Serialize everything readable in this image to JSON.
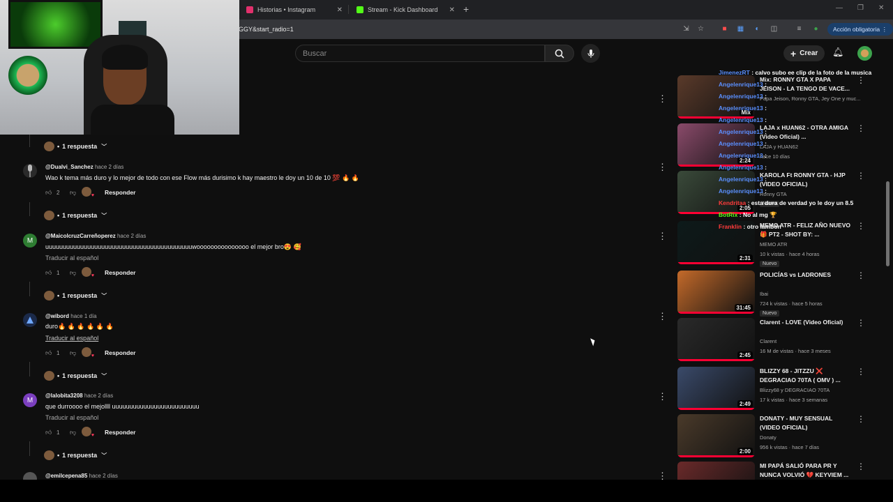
{
  "browser": {
    "tabs": [
      {
        "label": "Historias • Instagram",
        "color": "#e1306c"
      },
      {
        "label": "Stream - Kick Dashboard",
        "color": "#53fc18"
      }
    ],
    "url": "GGY&start_radio=1",
    "action_label": "Acción obligatoria"
  },
  "youtube": {
    "search_placeholder": "Buscar",
    "create_label": "Crear"
  },
  "comments": [
    {
      "handle": "@Dualvi_Sanchez",
      "time": "hace 2 días",
      "text": "Wao k tema más duro y lo mejor de todo con ese Flow más durisimo k hay maestro  le doy un 10 de 10 💯 🔥 🔥",
      "likes": "2",
      "reply_label": "Responder",
      "replies": "1 respuesta",
      "translate": ""
    },
    {
      "handle": "@MaicolcruzCarreñoperez",
      "time": "hace 2 días",
      "text": "uuuuuuuuuuuuuuuuuuuuuuuuuuuuuuuuuuuuuuuuuuwooooooooooooooo el mejor bro😍 🥰",
      "likes": "1",
      "reply_label": "Responder",
      "replies": "1 respuesta",
      "translate": "Traducir al español",
      "initial": "M",
      "av_color": "#2e7d32"
    },
    {
      "handle": "@wibord",
      "time": "hace 1 día",
      "text": "duro🔥 🔥 🔥 🔥 🔥 🔥",
      "likes": "1",
      "reply_label": "Responder",
      "replies": "1 respuesta",
      "translate": "Traducir al español"
    },
    {
      "handle": "@lalobita3208",
      "time": "hace 2 días",
      "text": "que durroooo el mejollll uuuuuuuuuuuuuuuuuuuuuuuuu",
      "likes": "1",
      "reply_label": "Responder",
      "replies": "1 respuesta",
      "translate": "Traducir al español",
      "initial": "M",
      "av_color": "#7b3fbf"
    },
    {
      "handle": "@emilcepena85",
      "time": "hace 2 días"
    }
  ],
  "top_replies": "1 respuesta",
  "sidebar": [
    {
      "title": "Mix: RONNY GTA X PAPA JEISON - LA TENGO DE VACE...",
      "meta1": "Papa Jeison, Ronny GTA, Jey One y muc...",
      "meta2": "",
      "badge": "",
      "duration": "Mix",
      "bg": "#5a3a2a"
    },
    {
      "title": "LAJA x HUAN62 - OTRA AMIGA (Video Oficial) ...",
      "meta1": "LAJA y HUAN62",
      "meta2": "hace 10 días",
      "badge": "",
      "duration": "2:24",
      "bg": "#8a4a6a"
    },
    {
      "title": "KAROLA Ft RONNY GTA - HJP (VIDEO OFICIAL)",
      "meta1": "Ronny GTA",
      "meta2": "",
      "badge": "Nuevo",
      "duration": "2:05",
      "bg": "#3a4a3a"
    },
    {
      "title": "MEMO ATR - FELIZ AÑO NUEVO 🎁 PT2 - SHOT BY: ...",
      "meta1": "MEMO ATR",
      "meta2": "10 k vistas · hace 4 horas",
      "badge": "Nuevo",
      "duration": "2:31",
      "bg": "#0d1a1a"
    },
    {
      "title": "POLICÍAS vs LADRONES",
      "meta1": "Ibai",
      "meta2": "724 k vistas · hace 5 horas",
      "badge": "Nuevo",
      "duration": "31:45",
      "bg": "#c46a2a"
    },
    {
      "title": "Clarent - LOVE (Video Oficial)",
      "meta1": "Clarent",
      "meta2": "16 M de vistas · hace 3 meses",
      "badge": "",
      "duration": "2:45",
      "bg": "#2a2a2a"
    },
    {
      "title": "BLIZZY 68 - JITZZU ❌ DEGRACIAO 70TA ( OMV ) ...",
      "meta1": "Blizzy68 y DEGRACIAO 70TA",
      "meta2": "17 k vistas · hace 3 semanas",
      "badge": "",
      "duration": "2:49",
      "bg": "#3a4a6a"
    },
    {
      "title": "DONATY - MUY SENSUAL (VIDEO OFICIAL)",
      "meta1": "Donaty",
      "meta2": "956 k vistas · hace 7 días",
      "badge": "",
      "duration": "2:00",
      "bg": "#4a3a2a"
    },
    {
      "title": "MI PAPÁ SALIÓ PARA PR Y NUNCA VOLVIÓ 💔 KEYVIEM ...",
      "meta1": "",
      "meta2": "",
      "badge": "",
      "duration": "",
      "bg": "#6a2a2a"
    }
  ],
  "chat": [
    {
      "user": "JimenezRT",
      "msg": ": calvo subo ee clip de la foto de la musica",
      "ucls": "u"
    },
    {
      "user": "Angelenrique13",
      "msg": ":",
      "ucls": "u"
    },
    {
      "user": "Angelenrique13",
      "msg": ":",
      "ucls": "u"
    },
    {
      "user": "Angelenrique13",
      "msg": ":",
      "ucls": "u"
    },
    {
      "user": "Angelenrique13",
      "msg": ":",
      "ucls": "u"
    },
    {
      "user": "Angelenrique13",
      "msg": ":",
      "ucls": "u"
    },
    {
      "user": "Angelenrique13",
      "msg": ":",
      "ucls": "u"
    },
    {
      "user": "Angelenrique13",
      "msg": ":",
      "ucls": "u"
    },
    {
      "user": "Angelenrique13",
      "msg": ":",
      "ucls": "u"
    },
    {
      "user": "Angelenrique13",
      "msg": ":",
      "ucls": "u"
    },
    {
      "user": "Angelenrique13",
      "msg": ":",
      "ucls": "u"
    },
    {
      "user": "Kendritaa",
      "msg": ": esta dura de verdad yo le doy un 8.5",
      "ucls": "r"
    },
    {
      "user": "BotRix",
      "msg": ": No al mg 🏆",
      "ucls": "g"
    },
    {
      "user": "Franklin",
      "msg": ": otro lambón",
      "ucls": "r"
    }
  ]
}
